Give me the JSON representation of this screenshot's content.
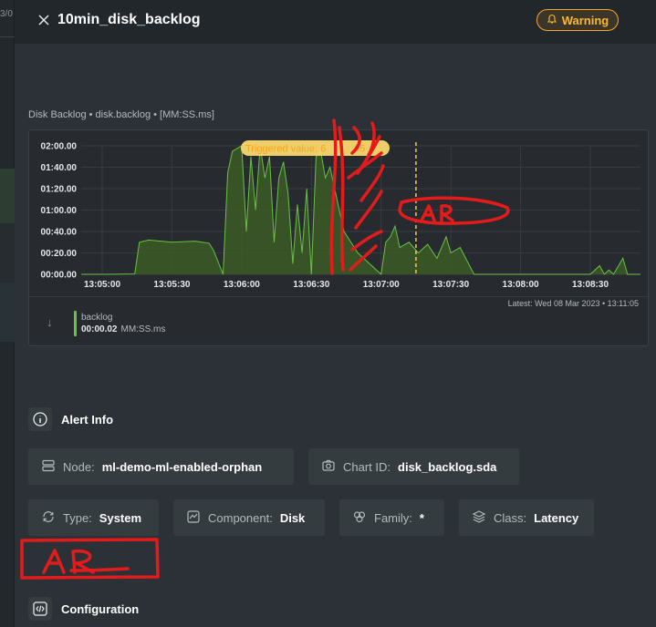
{
  "header": {
    "title": "10min_disk_backlog",
    "badge_label": "Warning"
  },
  "sidebar_fragment": "3/0",
  "chart": {
    "caption": "Disk Backlog • disk.backlog • [MM:SS.ms]",
    "trigger_label": "Triggered value: 6",
    "trigger_label_tail": "05",
    "latest": "Latest:  Wed 08 Mar 2023 • 13:11:05",
    "legend": {
      "name": "backlog",
      "value": "00:00.02",
      "unit": "MM:SS.ms"
    }
  },
  "chart_data": {
    "type": "area",
    "series": [
      {
        "name": "backlog",
        "x": [
          "13:04:40",
          "13:05:00",
          "13:05:14",
          "13:05:16",
          "13:05:20",
          "13:05:30",
          "13:05:40",
          "13:05:46",
          "13:05:48",
          "13:05:52",
          "13:05:54",
          "13:05:56",
          "13:06:00",
          "13:06:02",
          "13:06:04",
          "13:06:06",
          "13:06:08",
          "13:06:10",
          "13:06:12",
          "13:06:14",
          "13:06:16",
          "13:06:18",
          "13:06:20",
          "13:06:22",
          "13:06:24",
          "13:06:26",
          "13:06:28",
          "13:06:30",
          "13:06:32",
          "13:06:34",
          "13:06:36",
          "13:06:38",
          "13:06:40",
          "13:06:44",
          "13:06:50",
          "13:07:00",
          "13:07:02",
          "13:07:04",
          "13:07:06",
          "13:07:08",
          "13:07:12",
          "13:07:16",
          "13:07:20",
          "13:07:24",
          "13:07:28",
          "13:07:30",
          "13:07:34",
          "13:07:40",
          "13:08:00",
          "13:08:30",
          "13:08:34",
          "13:08:36",
          "13:08:38",
          "13:08:40",
          "13:08:44",
          "13:08:46",
          "13:08:50",
          "13:08:55"
        ],
        "y": [
          0,
          0,
          0.3,
          30,
          32,
          30,
          31,
          29,
          22,
          0,
          95,
          115,
          120,
          40,
          110,
          60,
          120,
          90,
          110,
          30,
          90,
          105,
          75,
          10,
          65,
          20,
          80,
          0,
          110,
          115,
          90,
          100,
          80,
          40,
          20,
          0,
          30,
          35,
          45,
          25,
          30,
          20,
          28,
          15,
          35,
          20,
          25,
          0,
          0,
          0,
          8,
          0,
          4,
          0,
          15,
          0,
          0,
          0
        ]
      }
    ],
    "x_ticks": [
      "13:05:00",
      "13:05:30",
      "13:06:00",
      "13:06:30",
      "13:07:00",
      "13:07:30",
      "13:08:00",
      "13:08:30"
    ],
    "y_ticks": [
      "00:00.00",
      "00:20.00",
      "00:40.00",
      "01:00.00",
      "01:20.00",
      "01:40.00",
      "02:00.00"
    ],
    "ylim": [
      0,
      120
    ],
    "trigger_x": "13:07:15",
    "grid": true,
    "colors": {
      "line": "#68c244",
      "fill": "#3c5a25",
      "trigger": "#f9c74f",
      "grid": "#353c40"
    }
  },
  "alert_info": {
    "heading": "Alert Info",
    "node": {
      "key": "Node:",
      "value": "ml-demo-ml-enabled-orphan"
    },
    "chart_id": {
      "key": "Chart ID:",
      "value": "disk_backlog.sda"
    },
    "type": {
      "key": "Type:",
      "value": "System"
    },
    "component": {
      "key": "Component:",
      "value": "Disk"
    },
    "family": {
      "key": "Family:",
      "value": "*"
    },
    "class": {
      "key": "Class:",
      "value": "Latency"
    }
  },
  "configuration": {
    "heading": "Configuration"
  },
  "icons": [
    "close-icon",
    "bell-icon",
    "down-arrow-icon",
    "info-icon",
    "server-icon",
    "chart-id-icon",
    "type-icon",
    "component-icon",
    "family-icon",
    "class-icon",
    "code-icon"
  ],
  "annotation_text": [
    "AR",
    "AR"
  ]
}
